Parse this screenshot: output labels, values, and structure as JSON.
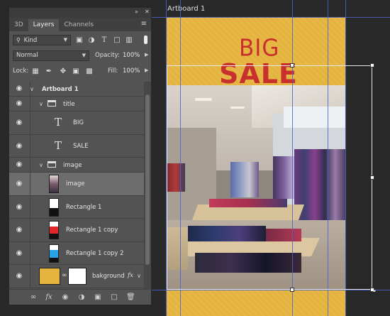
{
  "artboard": {
    "label": "Artboard 1",
    "background_color": "#e4b43e"
  },
  "design": {
    "big": "BIG",
    "sale": "SALE",
    "text_color": "#c8302d"
  },
  "panel": {
    "tabs": [
      {
        "label": "3D"
      },
      {
        "label": "Layers"
      },
      {
        "label": "Channels"
      }
    ],
    "active_tab": "Layers",
    "filter": {
      "label": "Kind"
    },
    "blend_mode": {
      "value": "Normal"
    },
    "opacity": {
      "label": "Opacity:",
      "value": "100%"
    },
    "lock": {
      "label": "Lock:"
    },
    "fill": {
      "label": "Fill:",
      "value": "100%"
    }
  },
  "layers": [
    {
      "name": "Artboard 1",
      "type": "artboard"
    },
    {
      "name": "title",
      "type": "group"
    },
    {
      "name": "BIG",
      "type": "text"
    },
    {
      "name": "SALE",
      "type": "text"
    },
    {
      "name": "image",
      "type": "group"
    },
    {
      "name": "image",
      "type": "image",
      "selected": true
    },
    {
      "name": "Rectangle 1",
      "type": "shape",
      "thumb_color": "#ffffff"
    },
    {
      "name": "Rectangle 1 copy",
      "type": "shape",
      "thumb_color": "#e02828"
    },
    {
      "name": "Rectangle 1 copy 2",
      "type": "shape",
      "thumb_color": "#2aa0e6"
    },
    {
      "name": "bakground",
      "type": "fill",
      "thumb_color": "#e4b43e",
      "fx": "fx"
    }
  ],
  "icons": [
    "eye-icon",
    "folder-icon",
    "text-tool-icon",
    "link-icon",
    "fx-icon",
    "mask-icon",
    "new-group-icon",
    "new-layer-icon",
    "trash-icon",
    "panel-menu-icon"
  ]
}
